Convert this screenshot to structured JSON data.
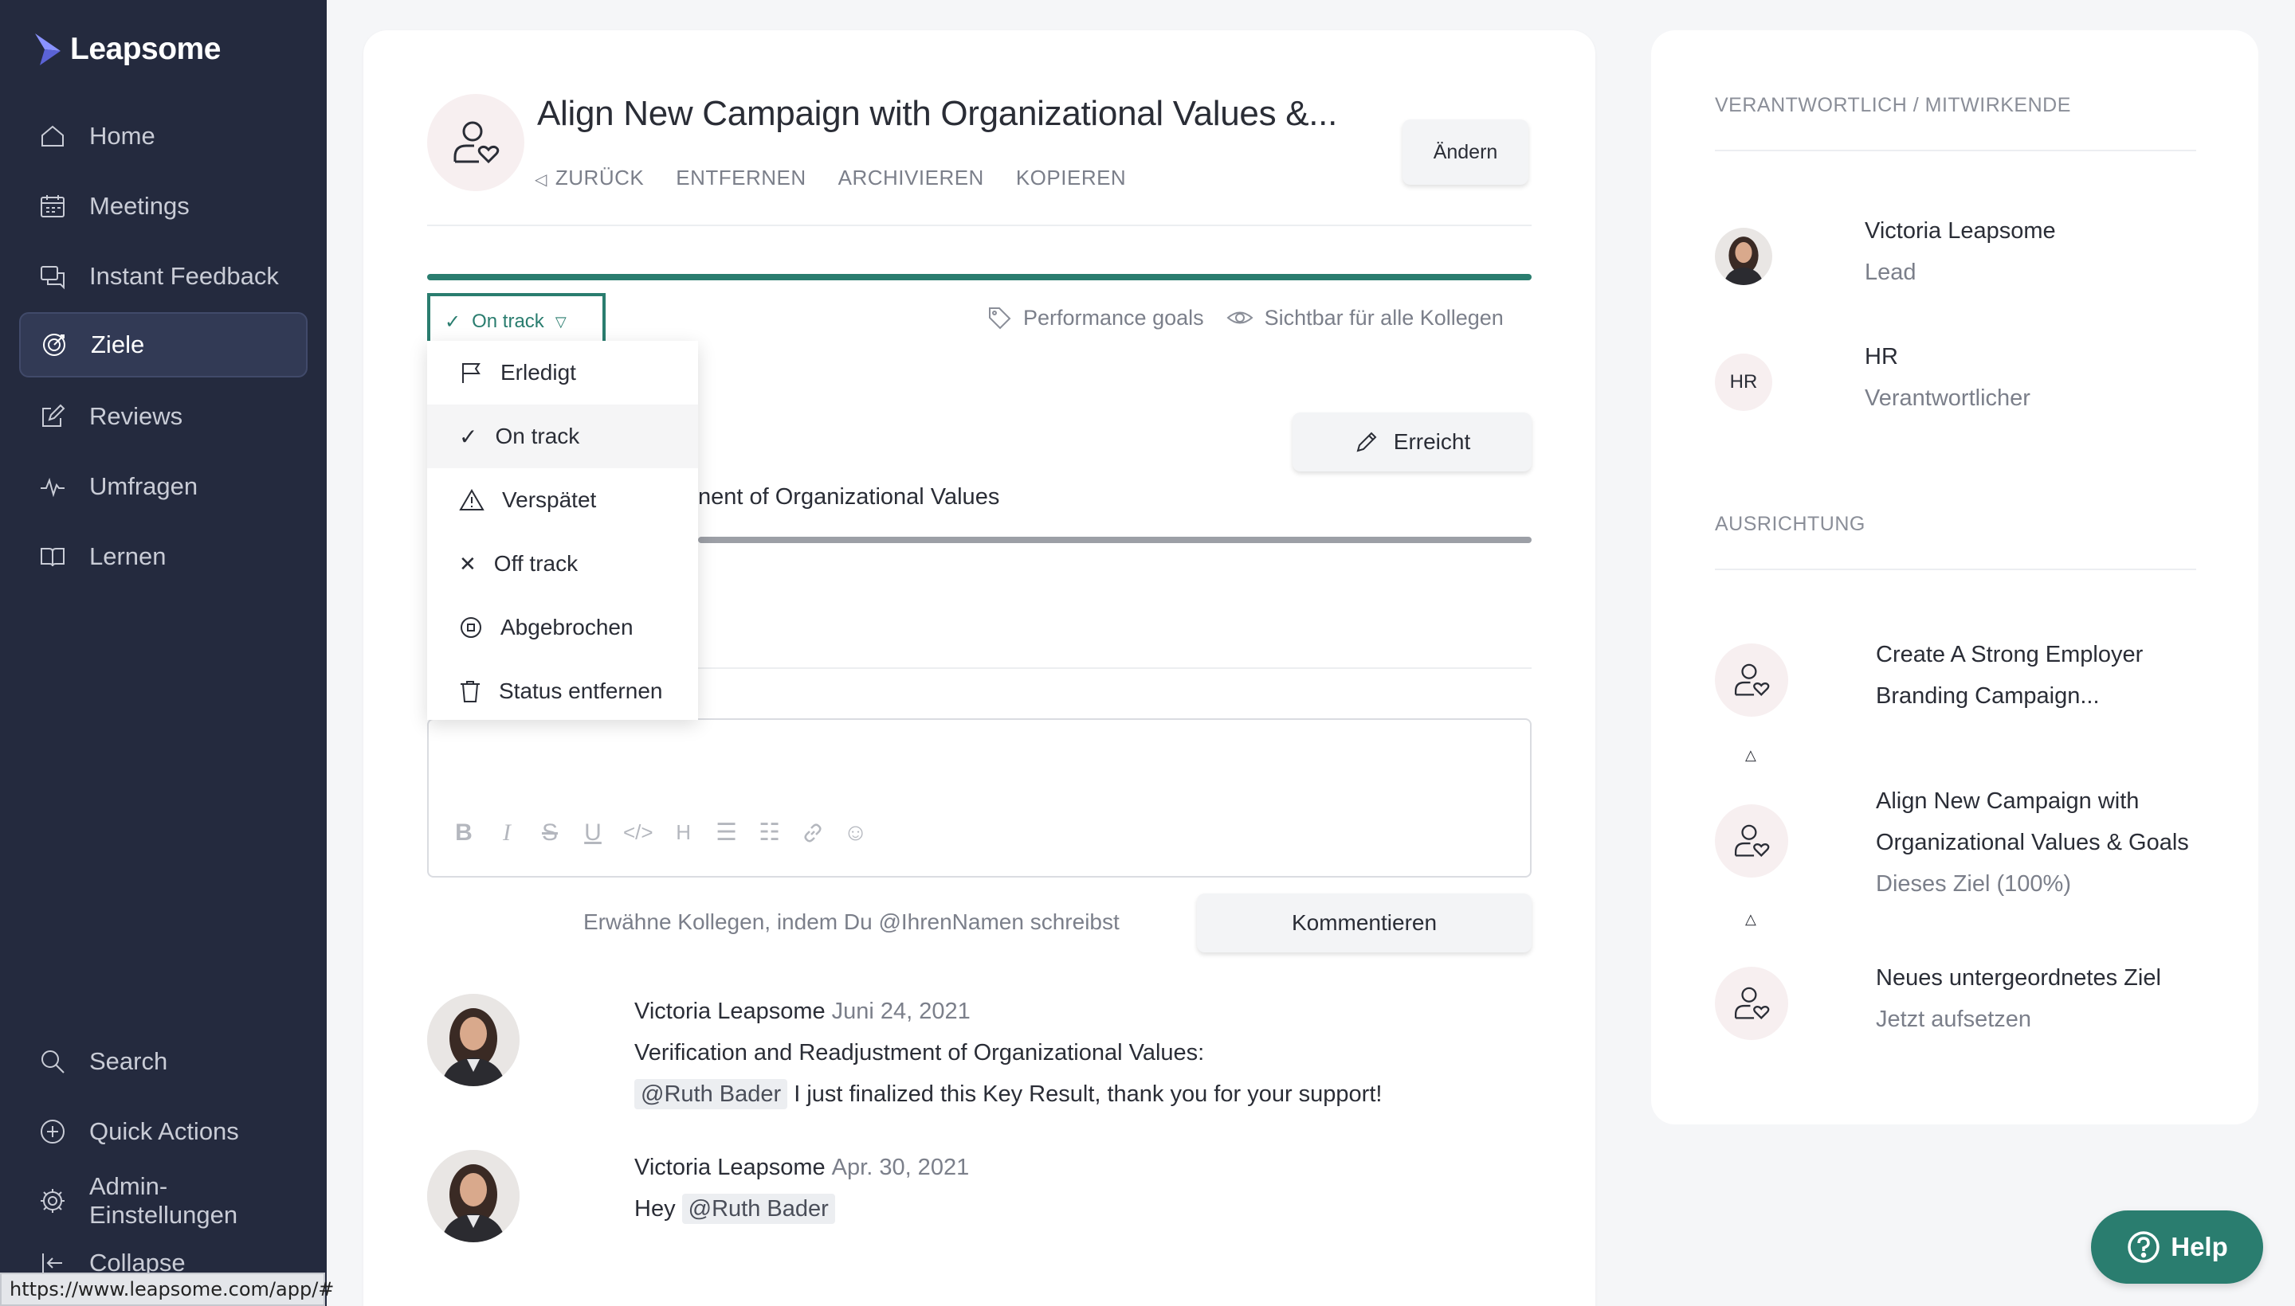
{
  "app": {
    "name": "Leapsome"
  },
  "sidebar": {
    "items": [
      {
        "label": "Home",
        "icon": "home-icon"
      },
      {
        "label": "Meetings",
        "icon": "calendar-icon"
      },
      {
        "label": "Instant Feedback",
        "icon": "chat-icon"
      },
      {
        "label": "Ziele",
        "icon": "target-icon",
        "active": true
      },
      {
        "label": "Reviews",
        "icon": "edit-icon"
      },
      {
        "label": "Umfragen",
        "icon": "pulse-icon"
      },
      {
        "label": "Lernen",
        "icon": "book-icon"
      }
    ],
    "bottom": [
      {
        "label": "Search",
        "icon": "search-icon"
      },
      {
        "label": "Quick Actions",
        "icon": "plus-circle-icon"
      },
      {
        "label": "Admin-Einstellungen",
        "icon": "gear-icon"
      },
      {
        "label": "Collapse",
        "icon": "collapse-icon"
      }
    ],
    "status_url": "https://www.leapsome.com/app/#"
  },
  "goal": {
    "title": "Align New Campaign with Organizational Values &...",
    "actions": {
      "back": "ZURÜCK",
      "remove": "ENTFERNEN",
      "archive": "ARCHIVIEREN",
      "copy": "KOPIEREN"
    },
    "change_button": "Ändern",
    "status": "On track",
    "tag": "Performance goals",
    "visibility": "Sichtbar für alle Kollegen",
    "progress": 1.0,
    "accent_color": "#2a7d6f"
  },
  "status_menu": {
    "items": [
      {
        "label": "Erledigt",
        "icon": "flag-icon"
      },
      {
        "label": "On track",
        "icon": "check-icon",
        "selected": true
      },
      {
        "label": "Verspätet",
        "icon": "warning-icon"
      },
      {
        "label": "Off track",
        "icon": "x-icon"
      },
      {
        "label": "Abgebrochen",
        "icon": "stop-circle-icon"
      },
      {
        "label": "Status entfernen",
        "icon": "trash-icon"
      }
    ]
  },
  "key_result": {
    "title_visible": "nent of Organizational Values",
    "button": "Erreicht"
  },
  "comment_box": {
    "hint": "Erwähne Kollegen, indem Du @IhrenNamen schreibst",
    "submit": "Kommentieren",
    "toolbar": [
      "B",
      "I",
      "S",
      "U",
      "</>",
      "H",
      "bullet-list",
      "numbered-list",
      "link",
      "emoji"
    ]
  },
  "comments": [
    {
      "author": "Victoria Leapsome",
      "date": "Juni 24, 2021",
      "line1": "Verification and Readjustment of Organizational Values:",
      "mention": "@Ruth Bader",
      "line2": "I just finalized this Key Result, thank you for your support!"
    },
    {
      "author": "Victoria Leapsome",
      "date": "Apr. 30, 2021",
      "prefix": "Hey",
      "mention": "@Ruth Bader"
    }
  ],
  "right_panel": {
    "owners_title": "VERANTWORTLICH / MITWIRKENDE",
    "owners": [
      {
        "name": "Victoria Leapsome",
        "role": "Lead"
      },
      {
        "name": "HR",
        "role": "Verantwortlicher",
        "initials": "HR"
      }
    ],
    "alignment_title": "AUSRICHTUNG",
    "alignment": [
      {
        "line1": "Create A Strong Employer",
        "line2": "Branding Campaign..."
      },
      {
        "line1": "Align New Campaign with",
        "line2": "Organizational Values & Goals",
        "sub": "Dieses Ziel (100%)"
      },
      {
        "line1": "Neues untergeordnetes Ziel",
        "sub": "Jetzt aufsetzen"
      }
    ]
  },
  "help": {
    "label": "Help"
  }
}
